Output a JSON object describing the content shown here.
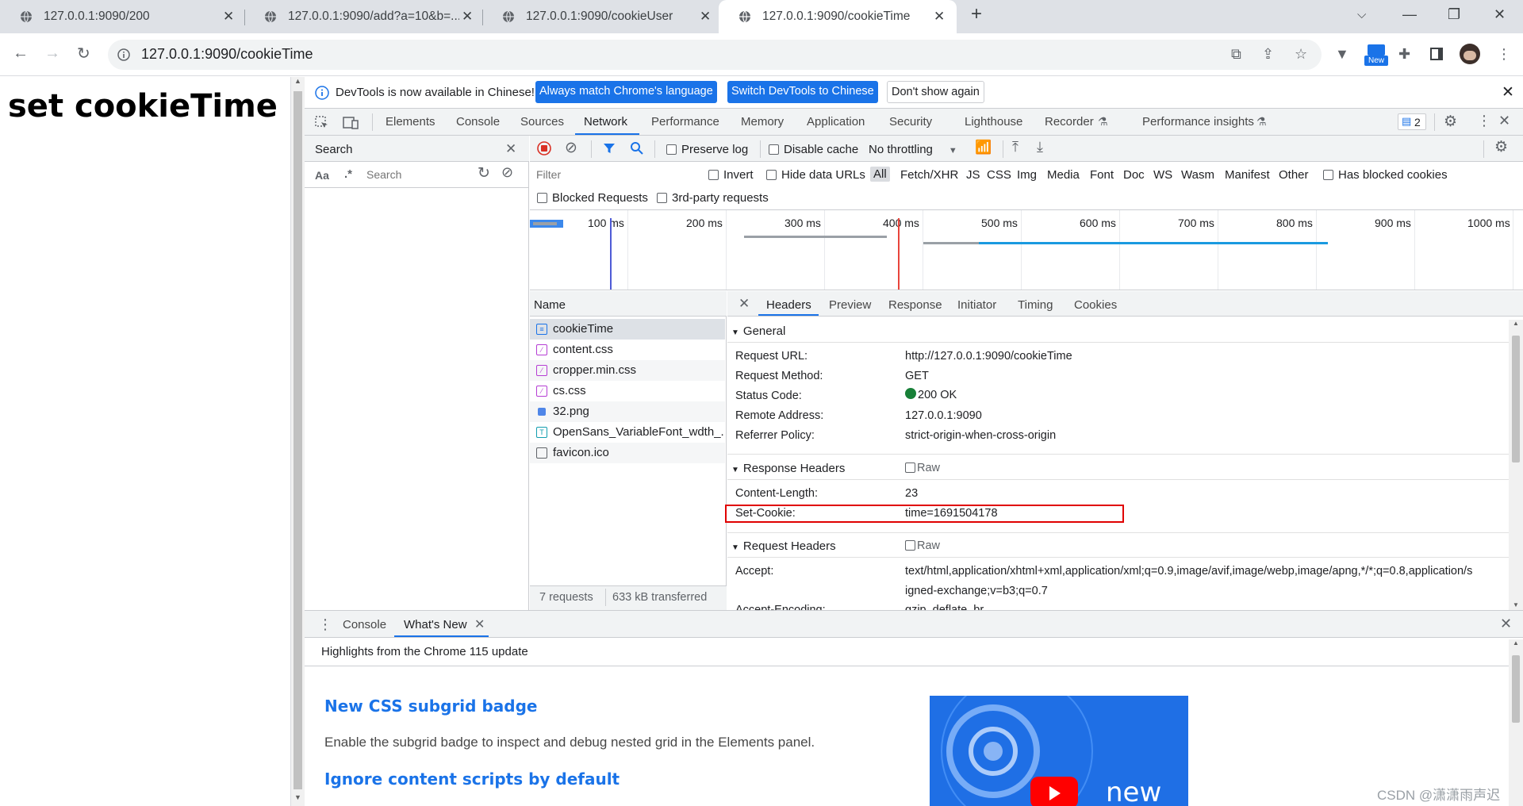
{
  "tabs": [
    {
      "title": "127.0.0.1:9090/200"
    },
    {
      "title": "127.0.0.1:9090/add?a=10&b=..."
    },
    {
      "title": "127.0.0.1:9090/cookieUser"
    },
    {
      "title": "127.0.0.1:9090/cookieTime"
    }
  ],
  "address": {
    "url": "127.0.0.1:9090/cookieTime"
  },
  "extension_badge": "New",
  "page": {
    "heading": "set cookieTime"
  },
  "devtools": {
    "infobar": {
      "message": "DevTools is now available in Chinese!",
      "btn_match": "Always match Chrome's language",
      "btn_switch": "Switch DevTools to Chinese",
      "btn_dismiss": "Don't show again"
    },
    "panel_tabs": [
      "Elements",
      "Console",
      "Sources",
      "Network",
      "Performance",
      "Memory",
      "Application",
      "Security",
      "Lighthouse",
      "Recorder",
      "Performance insights"
    ],
    "active_panel": "Network",
    "issues_count": "2",
    "search": {
      "title": "Search",
      "case_label": "Aa",
      "regex_label": ".*",
      "placeholder": "Search"
    },
    "network_toolbar": {
      "preserve_log": "Preserve log",
      "disable_cache": "Disable cache",
      "throttling": "No throttling"
    },
    "filter": {
      "placeholder": "Filter",
      "invert": "Invert",
      "hide_data_urls": "Hide data URLs",
      "types": [
        "All",
        "Fetch/XHR",
        "JS",
        "CSS",
        "Img",
        "Media",
        "Font",
        "Doc",
        "WS",
        "Wasm",
        "Manifest",
        "Other"
      ],
      "has_blocked_cookies": "Has blocked cookies",
      "blocked_requests": "Blocked Requests",
      "third_party": "3rd-party requests"
    },
    "timeline_ticks": [
      "100 ms",
      "200 ms",
      "300 ms",
      "400 ms",
      "500 ms",
      "600 ms",
      "700 ms",
      "800 ms",
      "900 ms",
      "1000 ms"
    ],
    "requests": {
      "column_name": "Name",
      "items": [
        {
          "name": "cookieTime",
          "type": "doc"
        },
        {
          "name": "content.css",
          "type": "css"
        },
        {
          "name": "cropper.min.css",
          "type": "css"
        },
        {
          "name": "cs.css",
          "type": "css"
        },
        {
          "name": "32.png",
          "type": "img"
        },
        {
          "name": "OpenSans_VariableFont_wdth_...",
          "type": "font"
        },
        {
          "name": "favicon.ico",
          "type": "other"
        }
      ],
      "summary_count": "7 requests",
      "summary_transferred": "633 kB transferred"
    },
    "detail_tabs": [
      "Headers",
      "Preview",
      "Response",
      "Initiator",
      "Timing",
      "Cookies"
    ],
    "active_detail_tab": "Headers",
    "general": {
      "title": "General",
      "request_url_key": "Request URL:",
      "request_url": "http://127.0.0.1:9090/cookieTime",
      "method_key": "Request Method:",
      "method": "GET",
      "status_key": "Status Code:",
      "status": "200 OK",
      "status_color": "#188038",
      "remote_key": "Remote Address:",
      "remote": "127.0.0.1:9090",
      "referrer_key": "Referrer Policy:",
      "referrer": "strict-origin-when-cross-origin"
    },
    "response_headers": {
      "title": "Response Headers",
      "raw": "Raw",
      "content_length_key": "Content-Length:",
      "content_length": "23",
      "set_cookie_key": "Set-Cookie:",
      "set_cookie": "time=1691504178",
      "highlight_color": "#e00000"
    },
    "request_headers": {
      "title": "Request Headers",
      "raw": "Raw",
      "accept_key": "Accept:",
      "accept_line1": "text/html,application/xhtml+xml,application/xml;q=0.9,image/avif,image/webp,image/apng,*/*;q=0.8,application/s",
      "accept_line2": "igned-exchange;v=b3;q=0.7",
      "encoding_key": "Accept-Encoding:",
      "encoding": "gzip, deflate, br"
    },
    "drawer": {
      "tabs": [
        "Console",
        "What's New"
      ],
      "active": "What's New",
      "highlight": "Highlights from the Chrome 115 update",
      "item1_title": "New CSS subgrid badge",
      "item1_desc": "Enable the subgrid badge to inspect and debug nested grid in the Elements panel.",
      "item2_title": "Ignore content scripts by default",
      "video_label": "new"
    }
  },
  "watermark": "CSDN @潇潇雨声迟"
}
